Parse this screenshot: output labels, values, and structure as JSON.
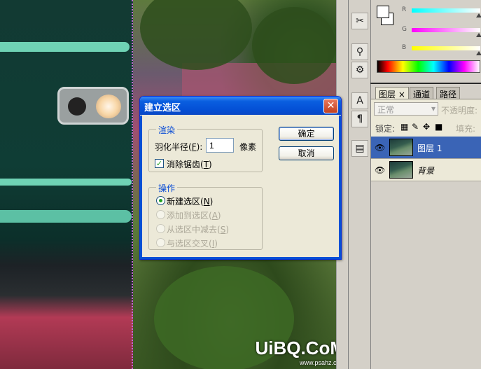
{
  "dialog": {
    "title": "建立选区",
    "render_group": "渲染",
    "feather_label_pre": "羽化半径(",
    "feather_key": "F",
    "feather_label_post": "):",
    "feather_value": "1",
    "feather_unit": "像素",
    "antialias_pre": "消除锯齿(",
    "antialias_key": "T",
    "antialias_post": ")",
    "antialias_checked": true,
    "operation_group": "操作",
    "ops": [
      {
        "pre": "新建选区(",
        "key": "N",
        "post": ")",
        "selected": true,
        "enabled": true
      },
      {
        "pre": "添加到选区(",
        "key": "A",
        "post": ")",
        "selected": false,
        "enabled": false
      },
      {
        "pre": "从选区中减去(",
        "key": "S",
        "post": ")",
        "selected": false,
        "enabled": false
      },
      {
        "pre": "与选区交叉(",
        "key": "I",
        "post": ")",
        "selected": false,
        "enabled": false
      }
    ],
    "ok_label": "确定",
    "cancel_label": "取消"
  },
  "color_panel": {
    "channels": [
      "R",
      "G",
      "B"
    ],
    "foreground": "#ffffff",
    "background": "#ffffff"
  },
  "layers_panel": {
    "tabs": [
      "图层",
      "通道",
      "路径"
    ],
    "blend_mode": "正常",
    "opacity_label": "不透明度:",
    "lock_label": "锁定:",
    "fill_label": "填充:",
    "layers": [
      {
        "name": "图层 1",
        "selected": true
      },
      {
        "name": "背景",
        "selected": false
      }
    ]
  },
  "watermark": {
    "main": "UiBQ.CoM",
    "sub": "www.psahz.com"
  }
}
